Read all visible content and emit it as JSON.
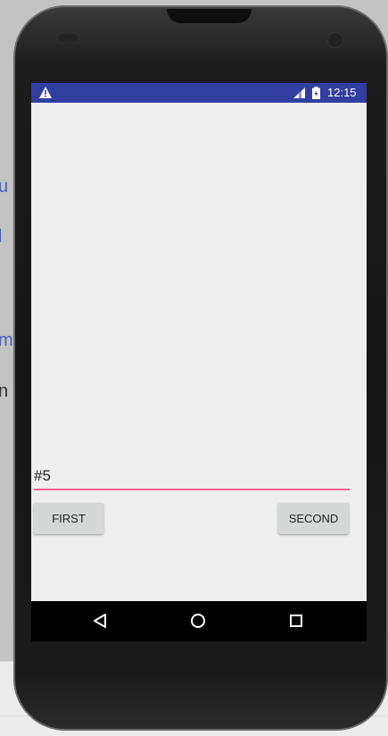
{
  "background_fragments": [
    {
      "text": "u",
      "style": "blue"
    },
    {
      "text": "l",
      "style": "blue"
    },
    {
      "text": "m",
      "style": "blue"
    },
    {
      "text": "n",
      "style": "dark"
    }
  ],
  "status_bar": {
    "time": "12:15",
    "color": "#303f9f",
    "icons": [
      "warning-icon",
      "signal-icon",
      "battery-icon"
    ]
  },
  "edit_text": {
    "value": "#5",
    "underline_color": "#f06292"
  },
  "buttons": {
    "first_label": "FIRST",
    "second_label": "SECOND"
  },
  "nav_bar": {
    "icons": [
      "back-icon",
      "home-icon",
      "recents-icon"
    ]
  }
}
